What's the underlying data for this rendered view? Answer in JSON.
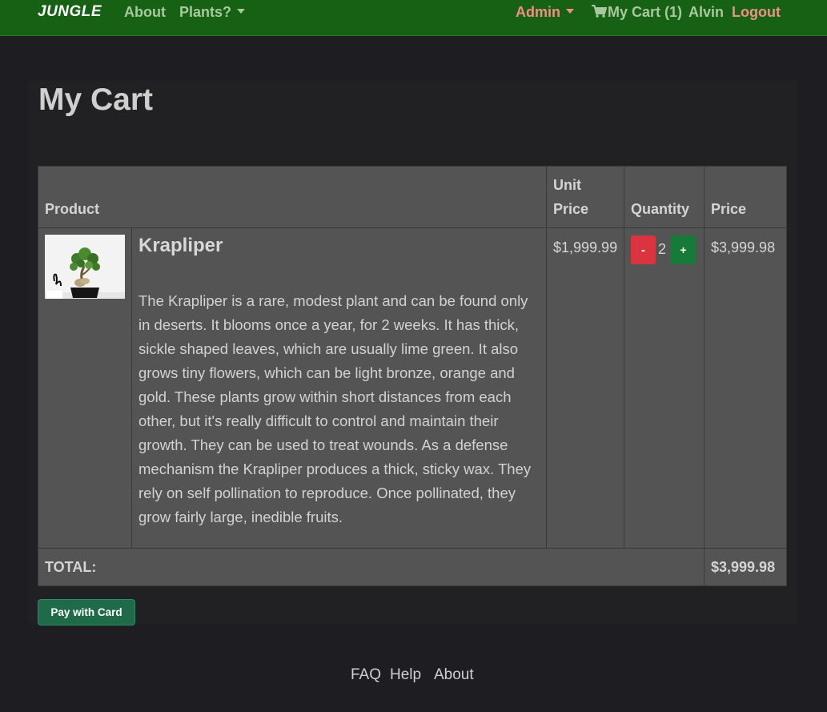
{
  "nav": {
    "brand": "JUNGLE",
    "about": "About",
    "plants": "Plants?",
    "admin": "Admin",
    "cart": "My Cart (1)",
    "user": "Alvin",
    "logout": "Logout"
  },
  "page": {
    "title": "My Cart"
  },
  "table": {
    "headers": {
      "product": "Product",
      "unit_price_1": "Unit",
      "unit_price_2": "Price",
      "quantity": "Quantity",
      "price": "Price"
    },
    "rows": [
      {
        "name": "Krapliper",
        "description": "The Krapliper is a rare, modest plant and can be found only in deserts. It blooms once a year, for 2 weeks. It has thick, sickle shaped leaves, which are usually lime green. It also grows tiny flowers, which can be light bronze, orange and gold. These plants grow within short distances from each other, but it's really difficult to control and maintain their growth. They can be used to treat wounds. As a defense mechanism the Krapliper produces a thick, sticky wax. They rely on self pollination to reproduce. Once pollinated, they grow fairly large, inedible fruits.",
        "unit_price": "$1,999.99",
        "quantity": "2",
        "price": "$3,999.98",
        "minus_label": "-",
        "plus_label": "+"
      }
    ],
    "total_label": "TOTAL:",
    "total_value": "$3,999.98"
  },
  "actions": {
    "pay_label": "Pay with Card"
  },
  "footer": {
    "links": [
      "FAQ",
      "Help",
      "About"
    ]
  },
  "colors": {
    "navbar": "#176114",
    "accent_link": "#f08f86",
    "minus_button": "#d9343f",
    "plus_button": "#187a39",
    "pay_button": "#1f6b49"
  }
}
